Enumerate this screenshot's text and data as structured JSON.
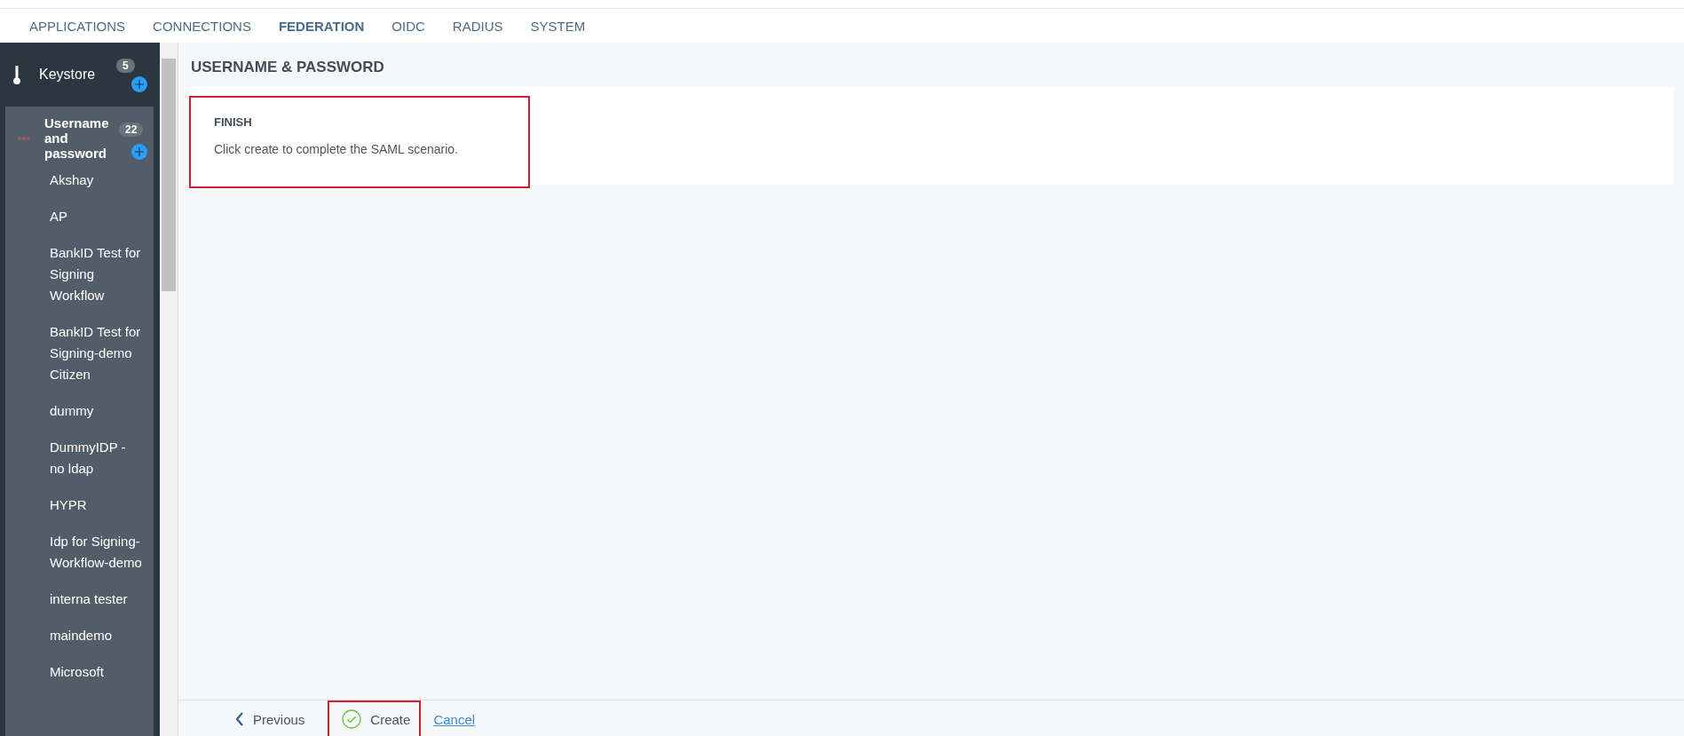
{
  "nav_tabs": [
    {
      "label": "APPLICATIONS",
      "selected": false
    },
    {
      "label": "CONNECTIONS",
      "selected": false
    },
    {
      "label": "FEDERATION",
      "selected": true
    },
    {
      "label": "OIDC",
      "selected": false
    },
    {
      "label": "RADIUS",
      "selected": false
    },
    {
      "label": "SYSTEM",
      "selected": false
    }
  ],
  "sidebar": {
    "keystore": {
      "label": "Keystore",
      "count": "5"
    },
    "group": {
      "label": "Username and password",
      "count": "22",
      "expanded": true,
      "items": [
        "Akshay",
        "AP",
        "BankID Test for Signing Workflow",
        "BankID Test for Signing-demo Citizen",
        "dummy",
        "DummyIDP - no ldap",
        "HYPR",
        "Idp for Signing-Workflow-demo",
        "interna tester",
        "maindemo",
        "Microsoft"
      ]
    }
  },
  "page_title": "USERNAME & PASSWORD",
  "step": {
    "title": "FINISH",
    "text": "Click create to complete the SAML scenario.",
    "highlighted": true
  },
  "footer": {
    "previous": "Previous",
    "create": "Create",
    "cancel": "Cancel",
    "create_highlighted": true
  }
}
